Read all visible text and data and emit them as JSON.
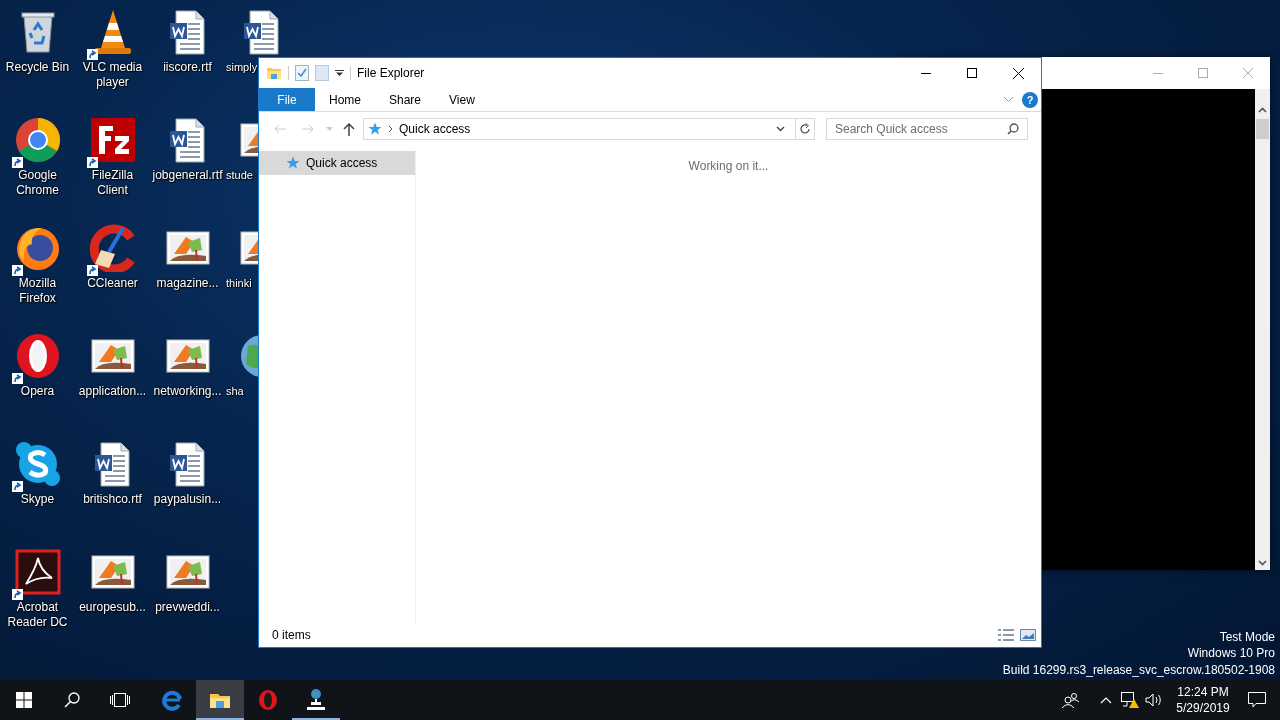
{
  "desktop": {
    "icons": [
      {
        "label": "Recycle Bin",
        "kind": "recycle",
        "shortcut": false
      },
      {
        "label": "Google Chrome",
        "kind": "chrome",
        "shortcut": true
      },
      {
        "label": "Mozilla Firefox",
        "kind": "firefox",
        "shortcut": true
      },
      {
        "label": "Opera",
        "kind": "opera",
        "shortcut": true
      },
      {
        "label": "Skype",
        "kind": "skype",
        "shortcut": true
      },
      {
        "label": "Acrobat Reader DC",
        "kind": "acrobat",
        "shortcut": true
      },
      {
        "label": "VLC media player",
        "kind": "vlc",
        "shortcut": true
      },
      {
        "label": "FileZilla Client",
        "kind": "filezilla",
        "shortcut": true
      },
      {
        "label": "CCleaner",
        "kind": "ccleaner",
        "shortcut": true
      },
      {
        "label": "application...",
        "kind": "image",
        "shortcut": false
      },
      {
        "label": "britishco.rtf",
        "kind": "word",
        "shortcut": false
      },
      {
        "label": "europesub...",
        "kind": "image",
        "shortcut": false
      },
      {
        "label": "iiscore.rtf",
        "kind": "word",
        "shortcut": false
      },
      {
        "label": "jobgeneral.rtf",
        "kind": "word",
        "shortcut": false
      },
      {
        "label": "magazine...",
        "kind": "image",
        "shortcut": false
      },
      {
        "label": "networking...",
        "kind": "image",
        "shortcut": false
      },
      {
        "label": "paypalusin...",
        "kind": "word",
        "shortcut": false
      },
      {
        "label": "prevweddi...",
        "kind": "image",
        "shortcut": false
      },
      {
        "label": "simply",
        "kind": "word",
        "shortcut": false
      },
      {
        "label": "stude",
        "kind": "image",
        "shortcut": false
      },
      {
        "label": "thinki",
        "kind": "image",
        "shortcut": false
      },
      {
        "label": "sha",
        "kind": "globe",
        "shortcut": false
      }
    ],
    "watermark": [
      "Test Mode",
      "Windows 10 Pro",
      "Build 16299.rs3_release_svc_escrow.180502-1908"
    ]
  },
  "explorer": {
    "title": "File Explorer",
    "ribbon_tabs": [
      {
        "label": "File",
        "selected": true
      },
      {
        "label": "Home",
        "selected": false
      },
      {
        "label": "Share",
        "selected": false
      },
      {
        "label": "View",
        "selected": false
      }
    ],
    "help": "?",
    "address": "Quick access",
    "search": {
      "placeholder": "Search Quick access"
    },
    "nav_items": [
      {
        "label": "Quick access",
        "selected": true
      }
    ],
    "message": "Working on it...",
    "status": "0 items"
  },
  "taskbar": {
    "apps": [
      {
        "kind": "edge",
        "active": false,
        "running": false
      },
      {
        "kind": "folder",
        "active": true,
        "running": true
      },
      {
        "kind": "opera",
        "active": false,
        "running": false
      },
      {
        "kind": "network",
        "active": false,
        "running": true
      }
    ],
    "clock": {
      "time": "12:24 PM",
      "date": "5/29/2019"
    }
  }
}
